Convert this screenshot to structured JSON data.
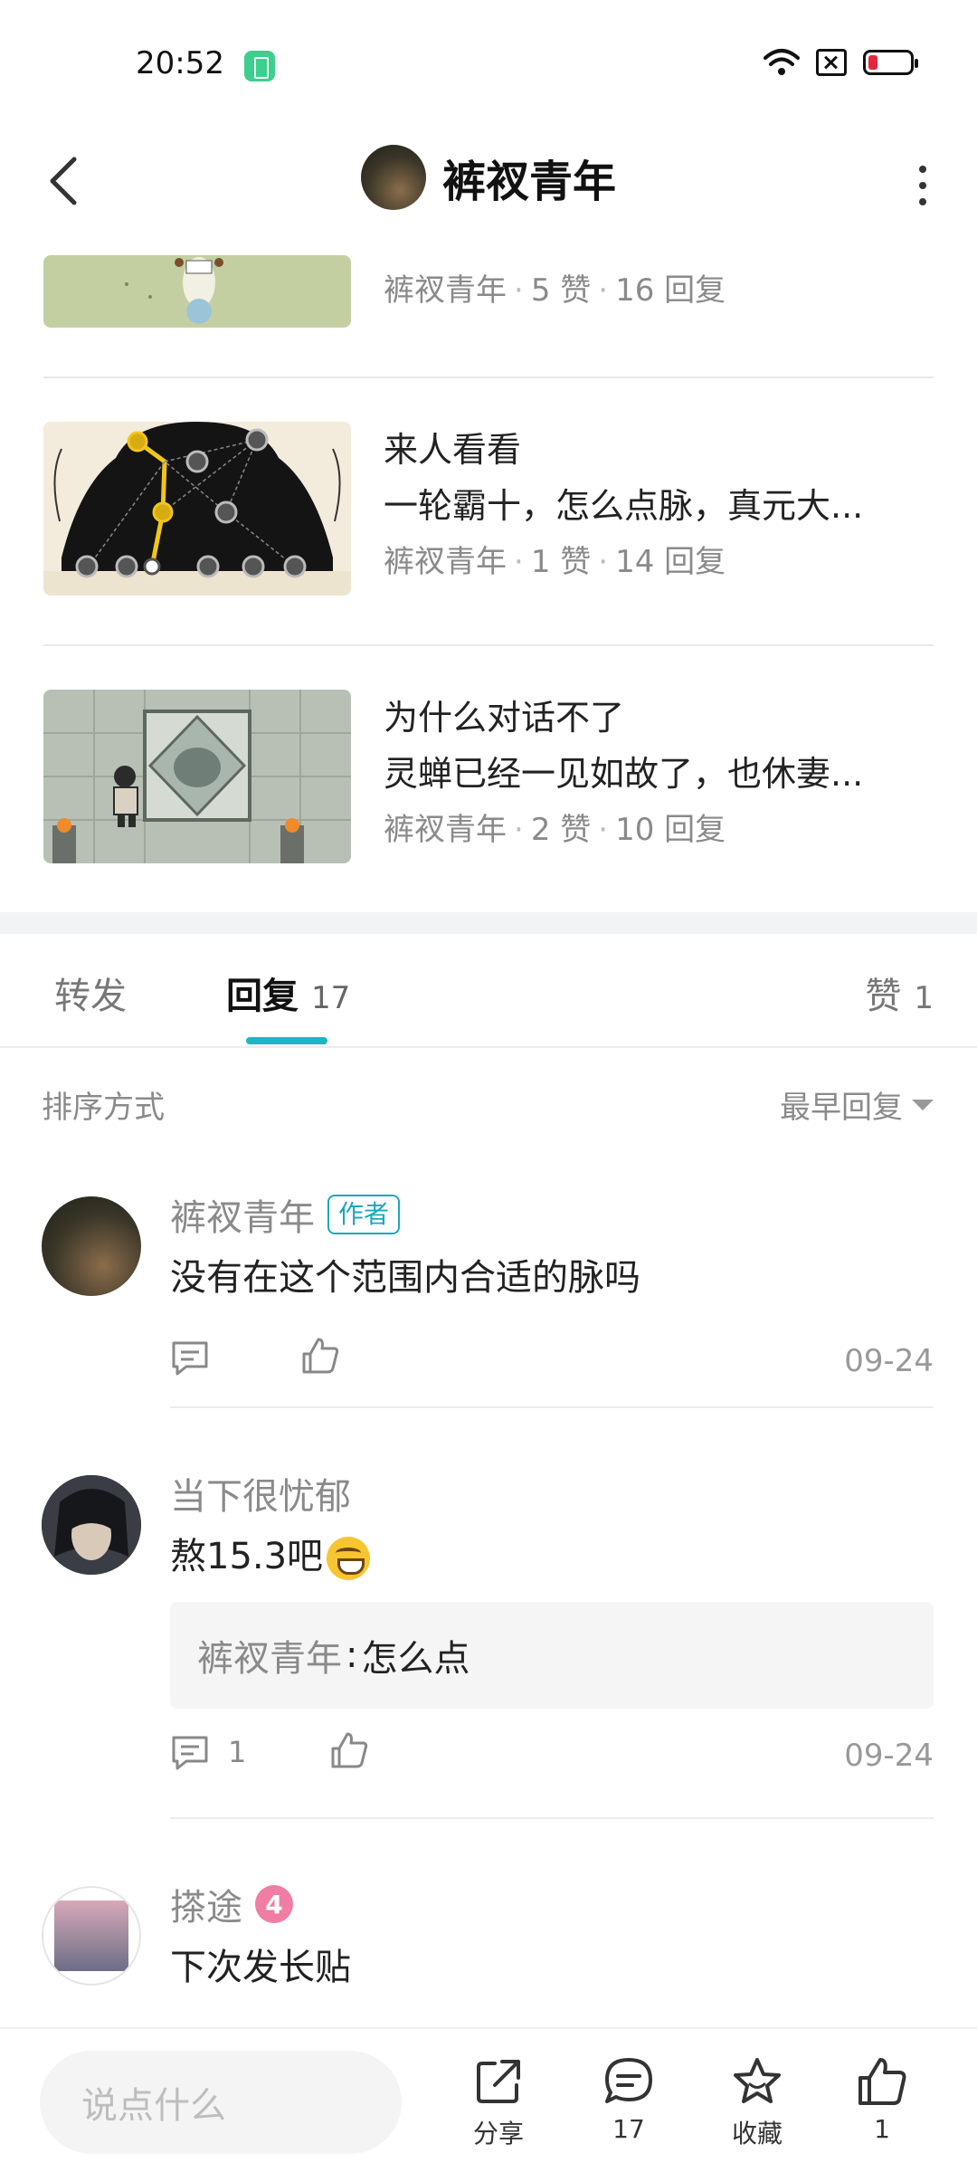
{
  "status_bar": {
    "time": "20:52"
  },
  "header": {
    "title": "裤衩青年"
  },
  "related_posts": [
    {
      "title": "",
      "desc": "",
      "author": "裤衩青年",
      "likes": "5 赞",
      "replies": "16 回复"
    },
    {
      "title": "来人看看",
      "desc": "一轮霸十，怎么点脉，真元大...",
      "author": "裤衩青年",
      "likes": "1 赞",
      "replies": "14 回复"
    },
    {
      "title": "为什么对话不了",
      "desc": "灵蝉已经一见如故了，也休妻...",
      "author": "裤衩青年",
      "likes": "2 赞",
      "replies": "10 回复"
    }
  ],
  "meta_dot": "·",
  "tabs": {
    "forward": {
      "label": "转发"
    },
    "reply": {
      "label": "回复",
      "count": "17"
    },
    "like": {
      "label": "赞",
      "count": "1"
    }
  },
  "sort": {
    "label": "排序方式",
    "value": "最早回复"
  },
  "comments": [
    {
      "name": "裤衩青年",
      "tag": "作者",
      "text": "没有在这个范围内合适的脉吗",
      "date": "09-24"
    },
    {
      "name": "当下很忧郁",
      "text": "熬15.3吧",
      "emoji": "grinning-face-emoji",
      "quote": {
        "name": "裤衩青年",
        "sep": ":",
        "text": "怎么点"
      },
      "reply_count": "1",
      "date": "09-24"
    },
    {
      "name": "搽途",
      "level": "4",
      "text": "下次发长贴"
    }
  ],
  "bottom_bar": {
    "input_placeholder": "说点什么",
    "share_label": "分享",
    "comment_count": "17",
    "favorite_label": "收藏",
    "like_count": "1"
  },
  "colors": {
    "accent": "#1fb5c7",
    "level_badge": "#f07da4",
    "battery_low": "#e2283a",
    "battery_saver": "#3ccf8e"
  }
}
